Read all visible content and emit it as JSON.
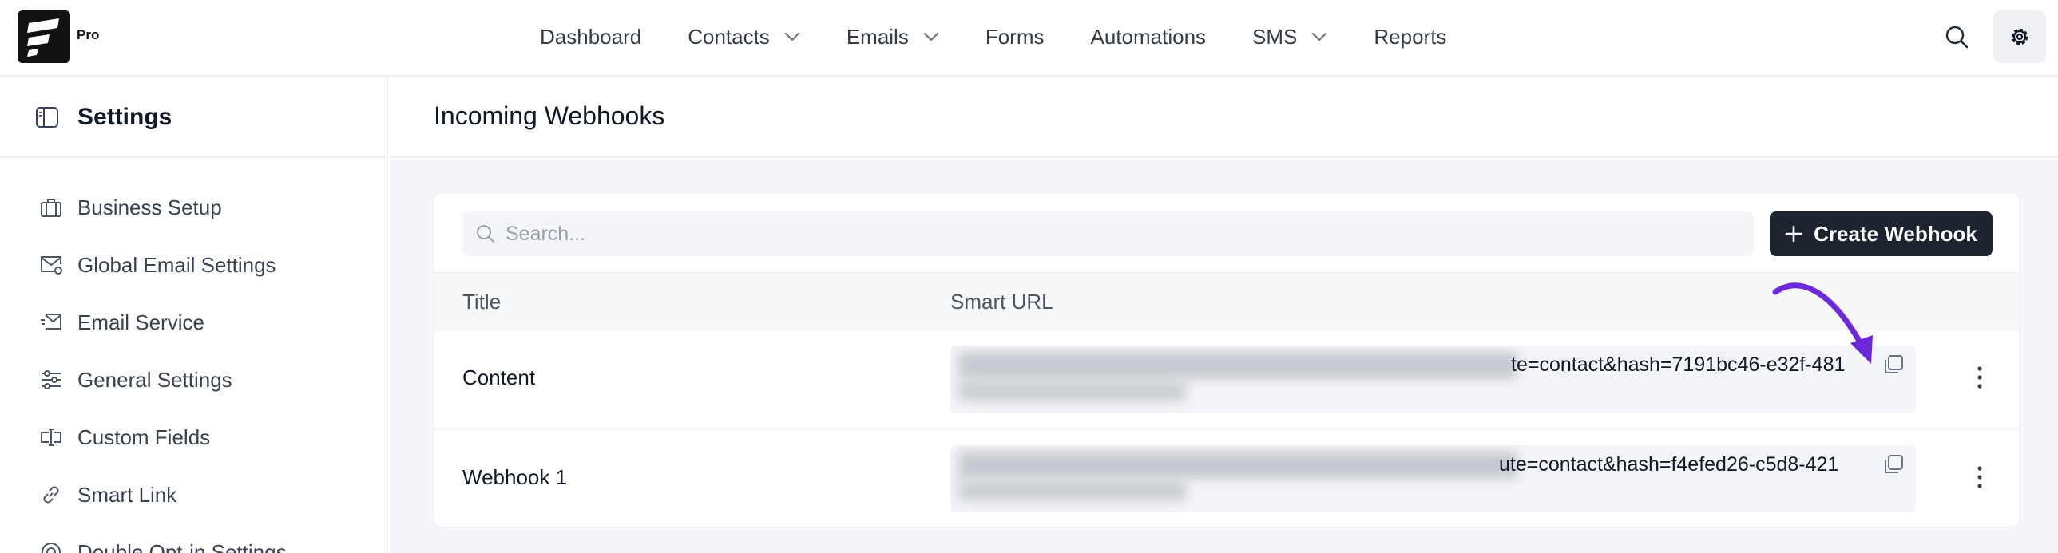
{
  "brand": {
    "tag": "Pro"
  },
  "nav": {
    "items": [
      {
        "label": "Dashboard",
        "has_dropdown": false
      },
      {
        "label": "Contacts",
        "has_dropdown": true
      },
      {
        "label": "Emails",
        "has_dropdown": true
      },
      {
        "label": "Forms",
        "has_dropdown": false
      },
      {
        "label": "Automations",
        "has_dropdown": false
      },
      {
        "label": "SMS",
        "has_dropdown": true
      },
      {
        "label": "Reports",
        "has_dropdown": false
      }
    ],
    "right_icons": [
      "search-icon",
      "gear-icon"
    ]
  },
  "sidebar": {
    "title": "Settings",
    "items": [
      {
        "label": "Business Setup",
        "icon": "briefcase-icon"
      },
      {
        "label": "Global Email Settings",
        "icon": "mail-gear-icon"
      },
      {
        "label": "Email Service",
        "icon": "mail-send-icon"
      },
      {
        "label": "General Settings",
        "icon": "sliders-icon"
      },
      {
        "label": "Custom Fields",
        "icon": "text-field-icon"
      },
      {
        "label": "Smart Link",
        "icon": "link-icon"
      },
      {
        "label": "Double Opt-in Settings",
        "icon": "check-circle-icon"
      }
    ]
  },
  "page": {
    "title": "Incoming Webhooks"
  },
  "toolbar": {
    "search_placeholder": "Search...",
    "create_label": "Create Webhook"
  },
  "table": {
    "columns": [
      "Title",
      "Smart URL"
    ],
    "rows": [
      {
        "title": "Content",
        "url_visible_tail": "te=contact&hash=7191bc46-e32f-481"
      },
      {
        "title": "Webhook 1",
        "url_visible_tail": "ute=contact&hash=f4efed26-c5d8-421"
      }
    ]
  },
  "colors": {
    "primary_button": "#1e2330",
    "annotation_arrow": "#6d28d9",
    "page_background": "#f4f5f8"
  }
}
